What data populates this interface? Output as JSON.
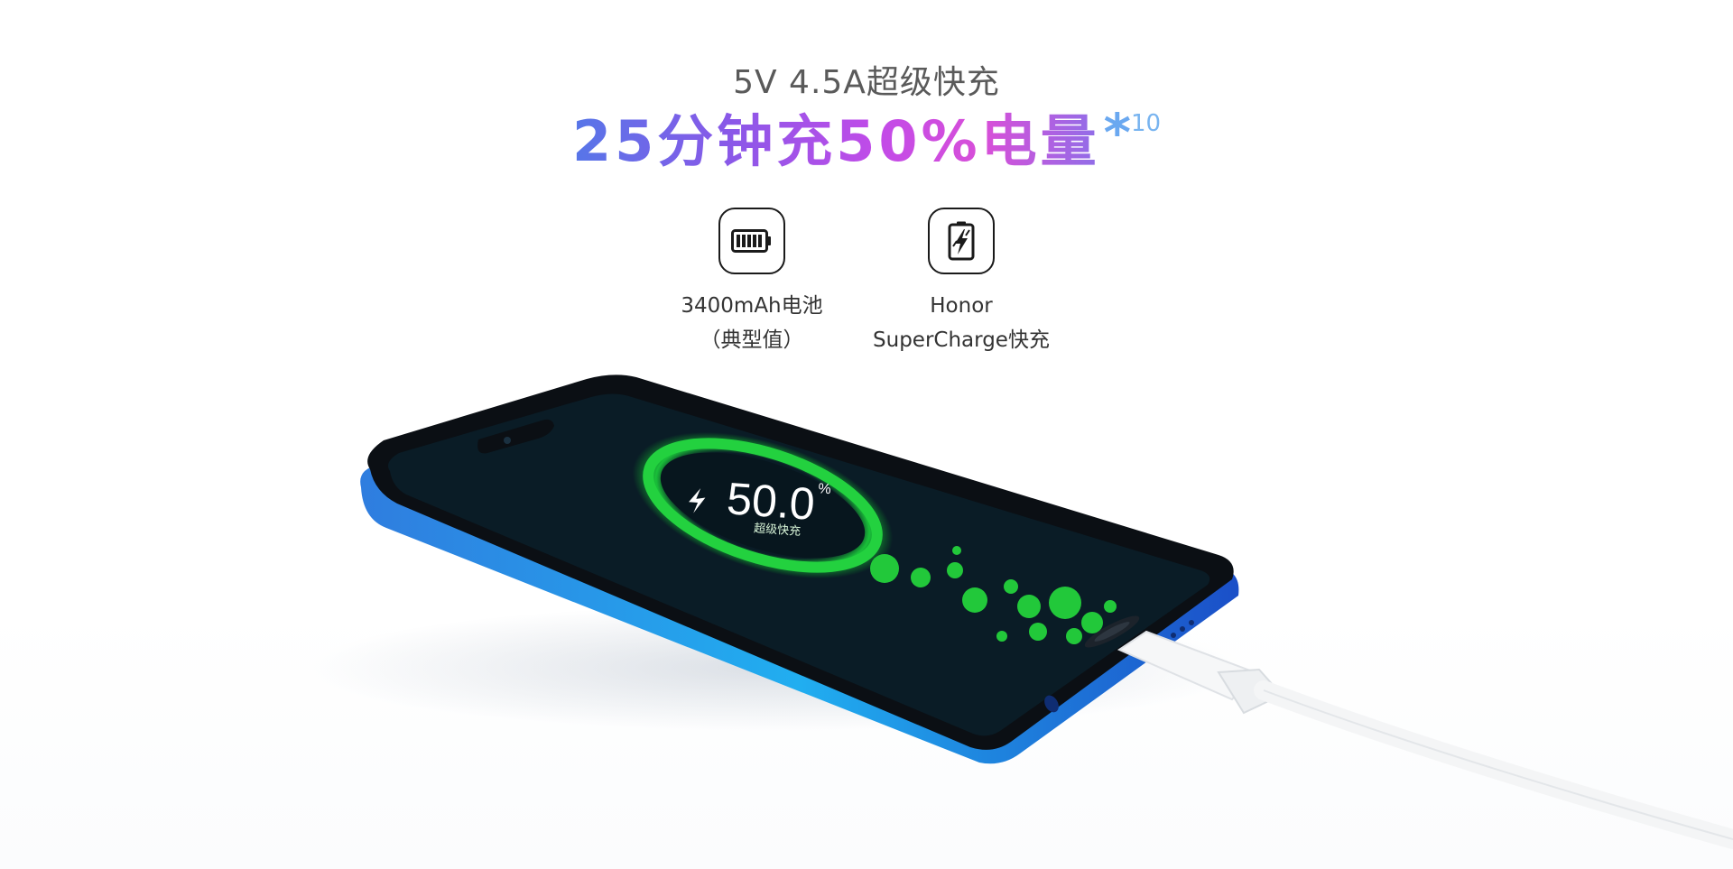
{
  "header": {
    "subtitle": "5V 4.5A超级快充",
    "headline": "25分钟充50%电量",
    "footnote_star": "*",
    "footnote_number": "10"
  },
  "features": [
    {
      "icon": "battery-icon",
      "line1": "3400mAh电池",
      "line2": "（典型值）"
    },
    {
      "icon": "supercharge-bolt-icon",
      "line1": "Honor",
      "line2": "SuperCharge快充"
    }
  ],
  "screen": {
    "percent": "50.0",
    "percent_sign": "%",
    "status": "超级快充",
    "progress_percent": 50
  },
  "colors": {
    "headline_start": "#5676e8",
    "headline_mid": "#c24be8",
    "footnote": "#78b4f0",
    "charge_green": "#22c83a",
    "phone_body": "#1f5fd0",
    "screen_bg": "#0a1c26"
  }
}
